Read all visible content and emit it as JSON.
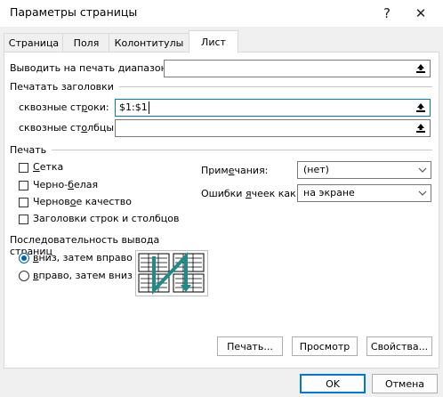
{
  "window": {
    "title": "Параметры страницы",
    "help_glyph": "?",
    "close_glyph": "✕"
  },
  "tabs": [
    {
      "label": "Страница",
      "active": false
    },
    {
      "label": "Поля",
      "active": false
    },
    {
      "label": "Колонтитулы",
      "active": false
    },
    {
      "label": "Лист",
      "active": true
    }
  ],
  "print_area": {
    "label": "Выводить на печать диапазон:",
    "value": ""
  },
  "print_titles": {
    "group_label": "Печатать заголовки",
    "rows_label": "сквозные строки:",
    "rows_value": "$1:$1",
    "cols_label": "сквозные столбцы:",
    "cols_value": ""
  },
  "print": {
    "group_label": "Печать",
    "checkboxes": [
      {
        "label": "Сетка",
        "checked": false
      },
      {
        "label": "Черно-белая",
        "checked": false
      },
      {
        "label": "Черновое качество",
        "checked": false
      },
      {
        "label": "Заголовки строк и столбцов",
        "checked": false
      }
    ],
    "comments_label": "Примечания:",
    "comments_value": "(нет)",
    "errors_label": "Ошибки ячеек как:",
    "errors_value": "на экране"
  },
  "page_order": {
    "group_label": "Последовательность вывода страниц",
    "options": [
      {
        "label": "вниз, затем вправо",
        "selected": true
      },
      {
        "label": "вправо, затем вниз",
        "selected": false
      }
    ]
  },
  "buttons": {
    "print": "Печать...",
    "preview": "Просмотр",
    "properties": "Свойства...",
    "ok": "OK",
    "cancel": "Отмена"
  },
  "colors": {
    "accent": "#0078d7",
    "arrow": "#1f8a8a"
  }
}
